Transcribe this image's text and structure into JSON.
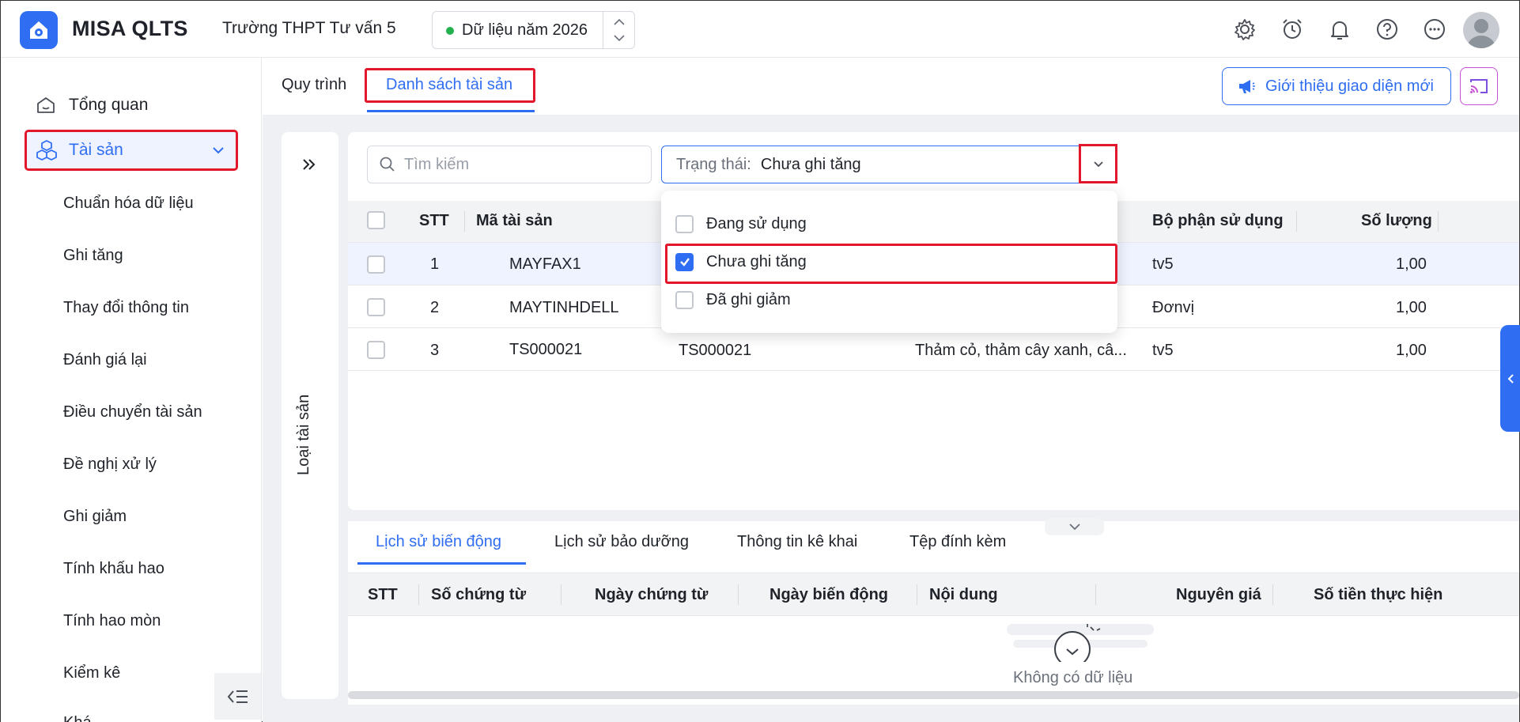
{
  "header": {
    "app_title": "MISA QLTS",
    "school": "Trường THPT Tư vấn 5",
    "year_label": "Dữ liệu năm 2026",
    "icons": [
      "settings-icon",
      "alarm-icon",
      "bell-icon",
      "help-icon",
      "more-icon"
    ]
  },
  "sidebar": {
    "overview": "Tổng quan",
    "assets": "Tài sản",
    "items": [
      "Chuẩn hóa dữ liệu",
      "Ghi tăng",
      "Thay đổi thông tin",
      "Đánh giá lại",
      "Điều chuyển tài sản",
      "Đề nghị xử lý",
      "Ghi giảm",
      "Tính khấu hao",
      "Tính hao mòn",
      "Kiểm kê",
      "Khá..."
    ]
  },
  "tabs": {
    "process": "Quy trình",
    "asset_list": "Danh sách tài sản"
  },
  "intro_button": "Giới thiệu giao diện mới",
  "left_panel_label": "Loại tài sản",
  "filters": {
    "search_placeholder": "Tìm kiếm",
    "status_label": "Trạng thái:",
    "status_value": "Chưa ghi tăng",
    "options": [
      {
        "label": "Đang sử dụng",
        "checked": false
      },
      {
        "label": "Chưa ghi tăng",
        "checked": true
      },
      {
        "label": "Đã ghi giảm",
        "checked": false
      }
    ]
  },
  "table": {
    "headers": {
      "stt": "STT",
      "code": "Mã tài sản",
      "dept": "Bộ phận sử dụng",
      "qty": "Số lượng"
    },
    "rows": [
      {
        "stt": "1",
        "code": "MAYFAX1",
        "name": "",
        "type": "",
        "dept": "tv5",
        "qty": "1,00"
      },
      {
        "stt": "2",
        "code": "MAYTINHDELL",
        "name": "",
        "type": "",
        "dept": "Đơnvị",
        "qty": "1,00"
      },
      {
        "stt": "3",
        "code": "TS000021",
        "name": "TS000021",
        "type": "Thảm cỏ, thảm cây xanh, câ...",
        "dept": "tv5",
        "qty": "1,00"
      }
    ]
  },
  "bottom": {
    "tabs": [
      "Lịch sử biến động",
      "Lịch sử bảo dưỡng",
      "Thông tin kê khai",
      "Tệp đính kèm"
    ],
    "headers": [
      "STT",
      "Số chứng từ",
      "Ngày chứng từ",
      "Ngày biến động",
      "Nội dung",
      "Nguyên giá",
      "Số tiền thực hiện"
    ],
    "empty": "Không có dữ liệu"
  },
  "colors": {
    "accent": "#2f6ef2",
    "highlight": "#e3172c",
    "status_dot": "#22b14c"
  }
}
